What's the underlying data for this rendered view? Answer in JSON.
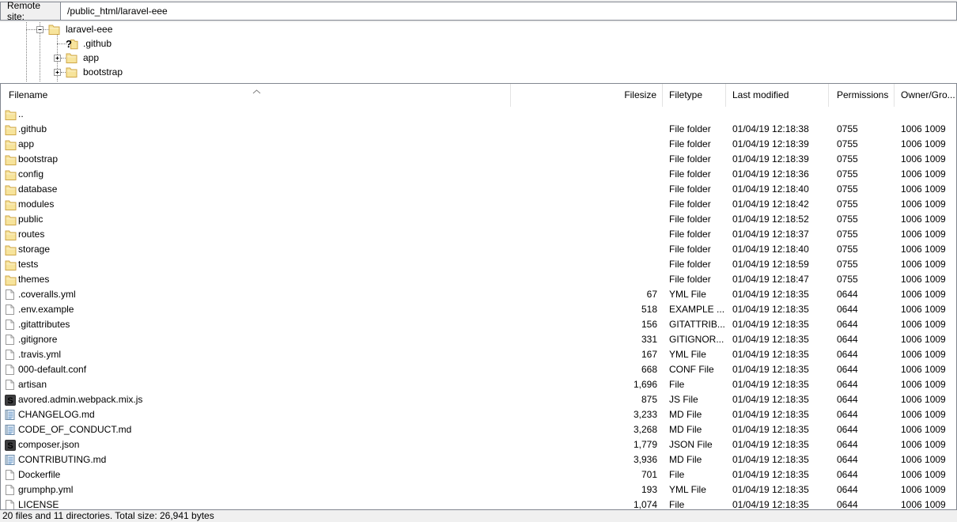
{
  "topbar": {
    "label": "Remote site:",
    "path": "/public_html/laravel-eee"
  },
  "tree": {
    "items": [
      {
        "label": "laravel-eee",
        "icon": "folder",
        "expander": "minus",
        "level": 0
      },
      {
        "label": ".github",
        "icon": "question",
        "expander": "none",
        "level": 1
      },
      {
        "label": "app",
        "icon": "folder",
        "expander": "plus",
        "level": 1
      },
      {
        "label": "bootstrap",
        "icon": "folder",
        "expander": "plus",
        "level": 1
      }
    ]
  },
  "list": {
    "columns": [
      "Filename",
      "Filesize",
      "Filetype",
      "Last modified",
      "Permissions",
      "Owner/Gro..."
    ],
    "sort": {
      "column": "Filename",
      "direction": "ascending"
    },
    "rows": [
      {
        "filename": "..",
        "icon": "folder",
        "filesize": "",
        "filetype": "",
        "last_modified": "",
        "permissions": "",
        "owner_group": ""
      },
      {
        "filename": ".github",
        "icon": "folder",
        "filesize": "",
        "filetype": "File folder",
        "last_modified": "01/04/19 12:18:38",
        "permissions": "0755",
        "owner_group": "1006 1009"
      },
      {
        "filename": "app",
        "icon": "folder",
        "filesize": "",
        "filetype": "File folder",
        "last_modified": "01/04/19 12:18:39",
        "permissions": "0755",
        "owner_group": "1006 1009"
      },
      {
        "filename": "bootstrap",
        "icon": "folder",
        "filesize": "",
        "filetype": "File folder",
        "last_modified": "01/04/19 12:18:39",
        "permissions": "0755",
        "owner_group": "1006 1009"
      },
      {
        "filename": "config",
        "icon": "folder",
        "filesize": "",
        "filetype": "File folder",
        "last_modified": "01/04/19 12:18:36",
        "permissions": "0755",
        "owner_group": "1006 1009"
      },
      {
        "filename": "database",
        "icon": "folder",
        "filesize": "",
        "filetype": "File folder",
        "last_modified": "01/04/19 12:18:40",
        "permissions": "0755",
        "owner_group": "1006 1009"
      },
      {
        "filename": "modules",
        "icon": "folder",
        "filesize": "",
        "filetype": "File folder",
        "last_modified": "01/04/19 12:18:42",
        "permissions": "0755",
        "owner_group": "1006 1009"
      },
      {
        "filename": "public",
        "icon": "folder",
        "filesize": "",
        "filetype": "File folder",
        "last_modified": "01/04/19 12:18:52",
        "permissions": "0755",
        "owner_group": "1006 1009"
      },
      {
        "filename": "routes",
        "icon": "folder",
        "filesize": "",
        "filetype": "File folder",
        "last_modified": "01/04/19 12:18:37",
        "permissions": "0755",
        "owner_group": "1006 1009"
      },
      {
        "filename": "storage",
        "icon": "folder",
        "filesize": "",
        "filetype": "File folder",
        "last_modified": "01/04/19 12:18:40",
        "permissions": "0755",
        "owner_group": "1006 1009"
      },
      {
        "filename": "tests",
        "icon": "folder",
        "filesize": "",
        "filetype": "File folder",
        "last_modified": "01/04/19 12:18:59",
        "permissions": "0755",
        "owner_group": "1006 1009"
      },
      {
        "filename": "themes",
        "icon": "folder",
        "filesize": "",
        "filetype": "File folder",
        "last_modified": "01/04/19 12:18:47",
        "permissions": "0755",
        "owner_group": "1006 1009"
      },
      {
        "filename": ".coveralls.yml",
        "icon": "doc",
        "filesize": "67",
        "filetype": "YML File",
        "last_modified": "01/04/19 12:18:35",
        "permissions": "0644",
        "owner_group": "1006 1009"
      },
      {
        "filename": ".env.example",
        "icon": "doc",
        "filesize": "518",
        "filetype": "EXAMPLE ...",
        "last_modified": "01/04/19 12:18:35",
        "permissions": "0644",
        "owner_group": "1006 1009"
      },
      {
        "filename": ".gitattributes",
        "icon": "doc",
        "filesize": "156",
        "filetype": "GITATTRIB...",
        "last_modified": "01/04/19 12:18:35",
        "permissions": "0644",
        "owner_group": "1006 1009"
      },
      {
        "filename": ".gitignore",
        "icon": "doc",
        "filesize": "331",
        "filetype": "GITIGNOR...",
        "last_modified": "01/04/19 12:18:35",
        "permissions": "0644",
        "owner_group": "1006 1009"
      },
      {
        "filename": ".travis.yml",
        "icon": "doc",
        "filesize": "167",
        "filetype": "YML File",
        "last_modified": "01/04/19 12:18:35",
        "permissions": "0644",
        "owner_group": "1006 1009"
      },
      {
        "filename": "000-default.conf",
        "icon": "doc",
        "filesize": "668",
        "filetype": "CONF File",
        "last_modified": "01/04/19 12:18:35",
        "permissions": "0644",
        "owner_group": "1006 1009"
      },
      {
        "filename": "artisan",
        "icon": "doc",
        "filesize": "1,696",
        "filetype": "File",
        "last_modified": "01/04/19 12:18:35",
        "permissions": "0644",
        "owner_group": "1006 1009"
      },
      {
        "filename": "avored.admin.webpack.mix.js",
        "icon": "code",
        "filesize": "875",
        "filetype": "JS File",
        "last_modified": "01/04/19 12:18:35",
        "permissions": "0644",
        "owner_group": "1006 1009"
      },
      {
        "filename": "CHANGELOG.md",
        "icon": "md",
        "filesize": "3,233",
        "filetype": "MD File",
        "last_modified": "01/04/19 12:18:35",
        "permissions": "0644",
        "owner_group": "1006 1009"
      },
      {
        "filename": "CODE_OF_CONDUCT.md",
        "icon": "md",
        "filesize": "3,268",
        "filetype": "MD File",
        "last_modified": "01/04/19 12:18:35",
        "permissions": "0644",
        "owner_group": "1006 1009"
      },
      {
        "filename": "composer.json",
        "icon": "code",
        "filesize": "1,779",
        "filetype": "JSON File",
        "last_modified": "01/04/19 12:18:35",
        "permissions": "0644",
        "owner_group": "1006 1009"
      },
      {
        "filename": "CONTRIBUTING.md",
        "icon": "md",
        "filesize": "3,936",
        "filetype": "MD File",
        "last_modified": "01/04/19 12:18:35",
        "permissions": "0644",
        "owner_group": "1006 1009"
      },
      {
        "filename": "Dockerfile",
        "icon": "doc",
        "filesize": "701",
        "filetype": "File",
        "last_modified": "01/04/19 12:18:35",
        "permissions": "0644",
        "owner_group": "1006 1009"
      },
      {
        "filename": "grumphp.yml",
        "icon": "doc",
        "filesize": "193",
        "filetype": "YML File",
        "last_modified": "01/04/19 12:18:35",
        "permissions": "0644",
        "owner_group": "1006 1009"
      },
      {
        "filename": "LICENSE",
        "icon": "doc",
        "filesize": "1,074",
        "filetype": "File",
        "last_modified": "01/04/19 12:18:35",
        "permissions": "0644",
        "owner_group": "1006 1009"
      }
    ]
  },
  "status_bar": {
    "text": "20 files and 11 directories. Total size: 26,941 bytes"
  },
  "colors": {
    "folder_body": "#f7e49c",
    "folder_border": "#cfa748",
    "code_icon_bg": "#3d3d3f",
    "code_icon_fg": "#ff933",
    "md_icon_line": "#5d8fc4",
    "md_icon_bg": "#e8f0f8",
    "panel_border": "#828790",
    "statusbar_bg": "#f0f0f0"
  }
}
